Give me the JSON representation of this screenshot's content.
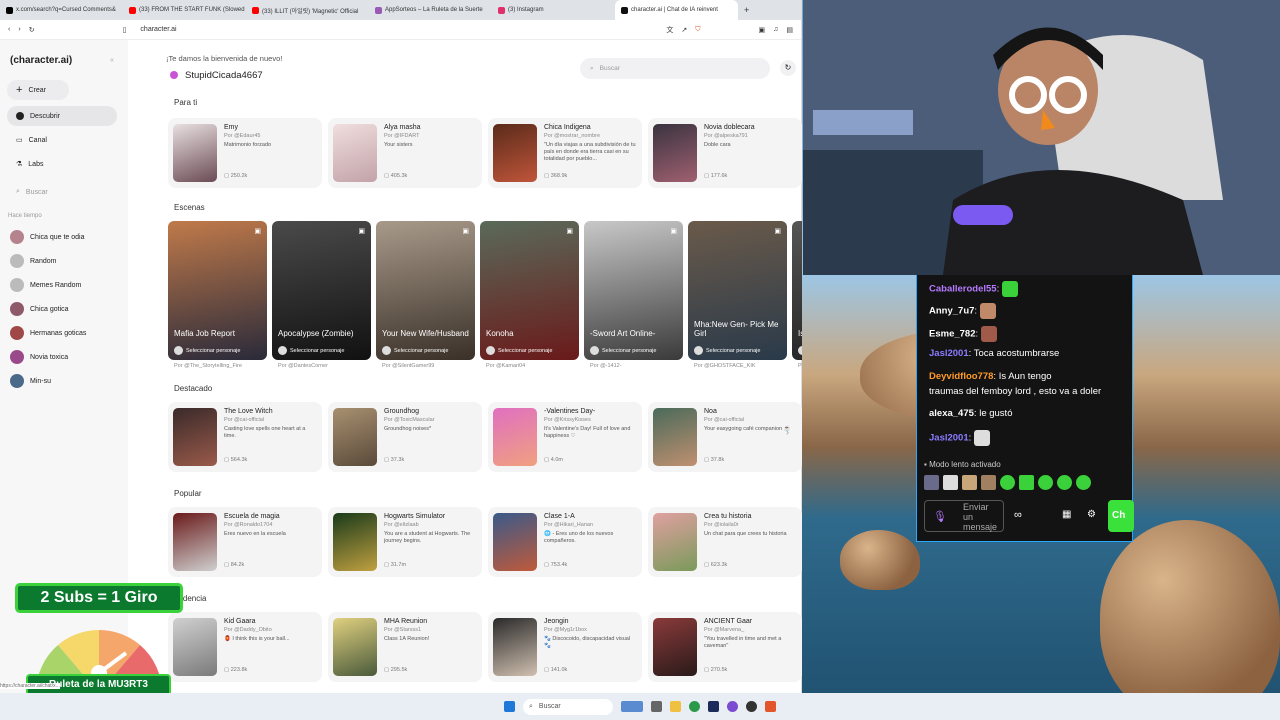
{
  "tabs": [
    {
      "label": "x.com/search?q=Cursed Comments&",
      "color": "#000000"
    },
    {
      "label": "(33) FROM THE START FUNK (Slowed",
      "color": "#ff0000"
    },
    {
      "label": "(33) ILLIT (아일릿) 'Magnetic' Official",
      "color": "#ff0000"
    },
    {
      "label": "AppSorteos – La Ruleta de la Suerte",
      "color": "#9b59b6"
    },
    {
      "label": "(3) Instagram",
      "color": "#e1306c"
    },
    {
      "label": "character.ai | Chat de IA reinvent",
      "color": "#111111"
    }
  ],
  "url": "character.ai",
  "sidebar": {
    "logo": "(character.ai)",
    "create": "Crear",
    "discover": "Descubrir",
    "channel": "Canal",
    "labs": "Labs",
    "search": "Buscar",
    "recent_heading": "Hace tiempo",
    "recent": [
      {
        "label": "Chica que te odia",
        "color": "#b5838d"
      },
      {
        "label": "Random",
        "color": "#bbbbbb"
      },
      {
        "label": "Memes Random",
        "color": "#bbbbbb"
      },
      {
        "label": "Chica gotica",
        "color": "#8e5a6a"
      },
      {
        "label": "Hermanas goticas",
        "color": "#a04848"
      },
      {
        "label": "Novia toxica",
        "color": "#9a4a8a"
      },
      {
        "label": "Min-su",
        "color": "#4a6a8a"
      }
    ]
  },
  "header": {
    "welcome": "¡Te damos la bienvenida de nuevo!",
    "username": "StupidCicada4667",
    "search": "Buscar"
  },
  "sections": {
    "for_you": "Para ti",
    "scenes": "Escenas",
    "featured": "Destacado",
    "popular": "Popular",
    "trending": "endencia"
  },
  "for_you": [
    {
      "title": "Emy",
      "by": "Por @Edaur45",
      "desc": "Matrimonio forzado",
      "count": "250.2k",
      "c1": "#e8e0e0",
      "c2": "#6b4b55"
    },
    {
      "title": "Alya masha",
      "by": "Por @IFDART",
      "desc": "Your sisters",
      "count": "405.3k",
      "c1": "#f0dede",
      "c2": "#c2a2a8"
    },
    {
      "title": "Chica Indigena",
      "by": "Por @mostrar_nombre",
      "desc": "\"Un día viajas a una subdivisión de tu país en donde era tierra casi en su totalidad por pueblo...",
      "count": "368.9k",
      "c1": "#5a2b1a",
      "c2": "#c0553a"
    },
    {
      "title": "Novia doblecara",
      "by": "Por @alpeska791",
      "desc": "Doble cara",
      "count": "177.6k",
      "c1": "#3a3340",
      "c2": "#a06070"
    }
  ],
  "scenes": [
    {
      "title": "Mafia Job Report",
      "by": "Por @The_Storytelling_Fire",
      "c1": "#c07a4a",
      "c2": "#2a2a3a"
    },
    {
      "title": "Apocalypse (Zombie)",
      "by": "Por @DantesCorner",
      "c1": "#4a4a4a",
      "c2": "#111111"
    },
    {
      "title": "Your New Wife/Husband",
      "by": "Por @SilentGamer99",
      "c1": "#a89a8a",
      "c2": "#3a3028"
    },
    {
      "title": "Konoha",
      "by": "Por @Kamari04",
      "c1": "#5a6a5a",
      "c2": "#6a1a1a"
    },
    {
      "title": "-Sword Art Online-",
      "by": "Por @-1412-",
      "c1": "#c8c8c8",
      "c2": "#3a3a3a"
    },
    {
      "title": "Mha:New Gen- Pick Me Girl",
      "by": "Por @GHOSTFACE_KIK",
      "c1": "#6a5a4a",
      "c2": "#2a3a4a"
    },
    {
      "title": "Is O",
      "by": "Por",
      "c1": "#555555",
      "c2": "#222222"
    }
  ],
  "featured": [
    {
      "title": "The Love Witch",
      "by": "Por @cai-official",
      "desc": "Casting love spells one heart at a time.",
      "count": "564.3k",
      "c1": "#3a2a2a",
      "c2": "#9a5a4a"
    },
    {
      "title": "Groundhog",
      "by": "Por @ToxicMascular",
      "desc": "Groundhog noises*",
      "count": "37.3k",
      "c1": "#a89070",
      "c2": "#5a4a3a"
    },
    {
      "title": "-Valentines Day-",
      "by": "Por @KrissyKisses",
      "desc": "It's Valentine's Day! Full of love and happiness ♡",
      "count": "4.0m",
      "c1": "#e070c0",
      "c2": "#f0a080"
    },
    {
      "title": "Noa",
      "by": "Por @cai-official",
      "desc": "Your easygoing café companion ☕",
      "count": "37.8k",
      "c1": "#4a6a5a",
      "c2": "#c09070"
    }
  ],
  "popular": [
    {
      "title": "Escuela de magia",
      "by": "Por @Ronaldo1704",
      "desc": "Eres nuevo en la escuela",
      "count": "84.2k",
      "c1": "#6a1a1a",
      "c2": "#d0d0d0"
    },
    {
      "title": "Hogwarts Simulator",
      "by": "Por @eltzlaab",
      "desc": "You are a student at Hogwarts. The journey begins.",
      "count": "31.7m",
      "c1": "#1a3a1a",
      "c2": "#c0a040"
    },
    {
      "title": "Clase 1-A",
      "by": "Por @Hikari_Hanan",
      "desc": "🌐 - Eres uno de los nuevos compañeros.",
      "count": "753.4k",
      "c1": "#3a5a8a",
      "c2": "#c05a3a"
    },
    {
      "title": "Crea tu historia",
      "by": "Por @iolaila0r",
      "desc": "Un chat para que crees tu historia",
      "count": "623.3k",
      "c1": "#e0a0a0",
      "c2": "#7a9a5a"
    }
  ],
  "trending": [
    {
      "title": "Kid Gaara",
      "by": "Por @Daddy_Obito",
      "desc": "🏮 I think this is your ball...",
      "count": "223.8k",
      "c1": "#d0d0d0",
      "c2": "#7a7a7a"
    },
    {
      "title": "MHA Reunion",
      "by": "Por @Starsss1",
      "desc": "Class 1A Reunion!",
      "count": "295.5k",
      "c1": "#e0d080",
      "c2": "#4a5a3a"
    },
    {
      "title": "Jeongin",
      "by": "Por @Myg1r1box",
      "desc": "🐾 Discocoido, discapacidad visual 🐾",
      "count": "141.0k",
      "c1": "#2a2a2a",
      "c2": "#d0c0b0"
    },
    {
      "title": "ANCIENT Gaar",
      "by": "Por @Marvena_",
      "desc": "\"You travelled in time and met a caveman\"",
      "count": "270.5k",
      "c1": "#8a3a3a",
      "c2": "#2a1a1a"
    }
  ],
  "chat": {
    "messages": [
      {
        "user": "Caballerodel55",
        "color": "#b57bff",
        "text": "",
        "emote": "#3ad13a"
      },
      {
        "user": "Anny_7u7",
        "color": "#ffffff",
        "text": "",
        "emote": "#c08a6a"
      },
      {
        "user": "Esme_782",
        "color": "#ffffff",
        "text": "",
        "emote": "#a05a4a"
      },
      {
        "user": "Jasl2001",
        "color": "#8a7bff",
        "text": "Toca acostumbrarse",
        "emote": ""
      },
      {
        "user": "Deyvidfloo778",
        "color": "#ff9a2a",
        "text": "Is Aun tengo",
        "emote": ""
      },
      {
        "user": "",
        "color": "#ffffff",
        "text": "traumas del femboy lord , esto va a doler",
        "emote": ""
      },
      {
        "user": "alexa_475",
        "color": "#ffffff",
        "text": "le gustó",
        "emote": ""
      },
      {
        "user": "Jasl2001",
        "color": "#8a7bff",
        "text": "",
        "emote": "#dddddd"
      }
    ],
    "slow_mode": "Modo lento activado",
    "input": "Enviar un mensaje",
    "chat_button": "Ch"
  },
  "overlay": {
    "subs": "2 Subs = 1 Giro",
    "wheel": "Ruleta de la MU3RT3",
    "status_url": "https://character.ai/chat/x...",
    "bottom_by": "SoloKGirlbox4"
  },
  "taskbar": {
    "search": "Buscar"
  }
}
